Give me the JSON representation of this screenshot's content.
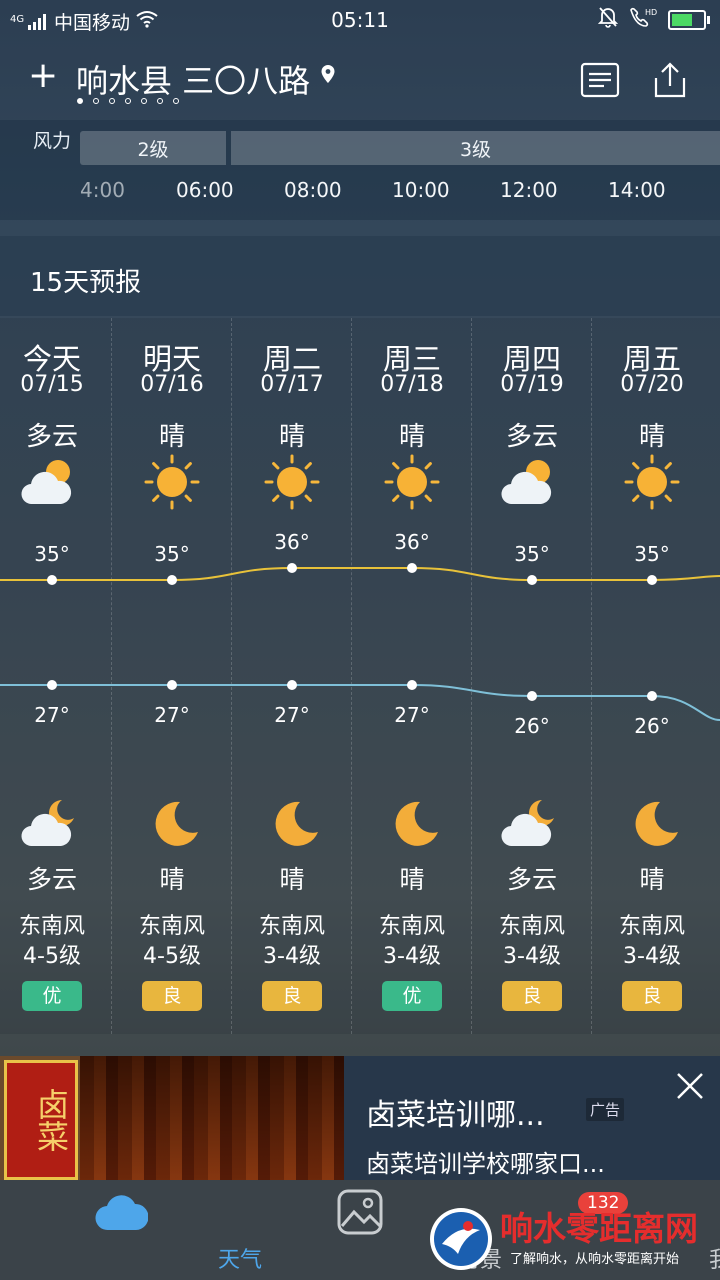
{
  "status_bar": {
    "network": "4G",
    "carrier": "中国移动",
    "time": "05:11"
  },
  "header": {
    "add": "+",
    "city": "响水县 三〇八路",
    "page_count": 7,
    "active_page": 0
  },
  "wind": {
    "label": "风力",
    "segments": [
      "2级",
      "3级"
    ],
    "hours": [
      "4:00",
      "06:00",
      "08:00",
      "10:00",
      "12:00",
      "14:00"
    ]
  },
  "forecast": {
    "title": "15天预报",
    "days": [
      {
        "day": "今天",
        "date": "07/15",
        "day_cond": "多云",
        "day_icon": "partly-cloudy-day-icon",
        "high": "35°",
        "night_icon": "partly-cloudy-night-icon",
        "low": "27°",
        "night_cond": "多云",
        "wind_dir": "东南风",
        "wind_level": "4-5级",
        "aqi": "优",
        "aqi_level": "good"
      },
      {
        "day": "明天",
        "date": "07/16",
        "day_cond": "晴",
        "day_icon": "sun-icon",
        "high": "35°",
        "night_icon": "moon-icon",
        "low": "27°",
        "night_cond": "晴",
        "wind_dir": "东南风",
        "wind_level": "4-5级",
        "aqi": "良",
        "aqi_level": "fair"
      },
      {
        "day": "周二",
        "date": "07/17",
        "day_cond": "晴",
        "day_icon": "sun-icon",
        "high": "36°",
        "night_icon": "moon-icon",
        "low": "27°",
        "night_cond": "晴",
        "wind_dir": "东南风",
        "wind_level": "3-4级",
        "aqi": "良",
        "aqi_level": "fair"
      },
      {
        "day": "周三",
        "date": "07/18",
        "day_cond": "晴",
        "day_icon": "sun-icon",
        "high": "36°",
        "night_icon": "moon-icon",
        "low": "27°",
        "night_cond": "晴",
        "wind_dir": "东南风",
        "wind_level": "3-4级",
        "aqi": "优",
        "aqi_level": "good"
      },
      {
        "day": "周四",
        "date": "07/19",
        "day_cond": "多云",
        "day_icon": "partly-cloudy-day-icon",
        "high": "35°",
        "night_icon": "partly-cloudy-night-icon",
        "low": "26°",
        "night_cond": "多云",
        "wind_dir": "东南风",
        "wind_level": "3-4级",
        "aqi": "良",
        "aqi_level": "fair"
      },
      {
        "day": "周五",
        "date": "07/20",
        "day_cond": "晴",
        "day_icon": "sun-icon",
        "high": "35°",
        "night_icon": "moon-icon",
        "low": "26°",
        "night_cond": "晴",
        "wind_dir": "东南风",
        "wind_level": "3-4级",
        "aqi": "良",
        "aqi_level": "fair"
      }
    ],
    "high_values": [
      35,
      35,
      36,
      36,
      35,
      35
    ],
    "low_values": [
      27,
      27,
      27,
      27,
      26,
      26
    ]
  },
  "ad": {
    "sign_text": "卤菜",
    "title": "卤菜培训哪...",
    "tag": "广告",
    "subtitle": "卤菜培训学校哪家口..."
  },
  "tabbar": {
    "tabs": [
      {
        "label": "天气",
        "icon": "cloud-icon"
      },
      {
        "label": "时景",
        "icon": "photo-icon"
      },
      {
        "label": "我",
        "icon": "user-icon"
      }
    ],
    "badge": "132"
  },
  "watermark": {
    "title": "响水零距离网",
    "subtitle": "了解响水，从响水零距离开始"
  },
  "colors": {
    "accent": "#4ea6ea",
    "aqi_good": "#3ab98a",
    "aqi_fair": "#e8b63e",
    "high_curve": "#e8c23a",
    "low_curve": "#7fc0d8"
  }
}
